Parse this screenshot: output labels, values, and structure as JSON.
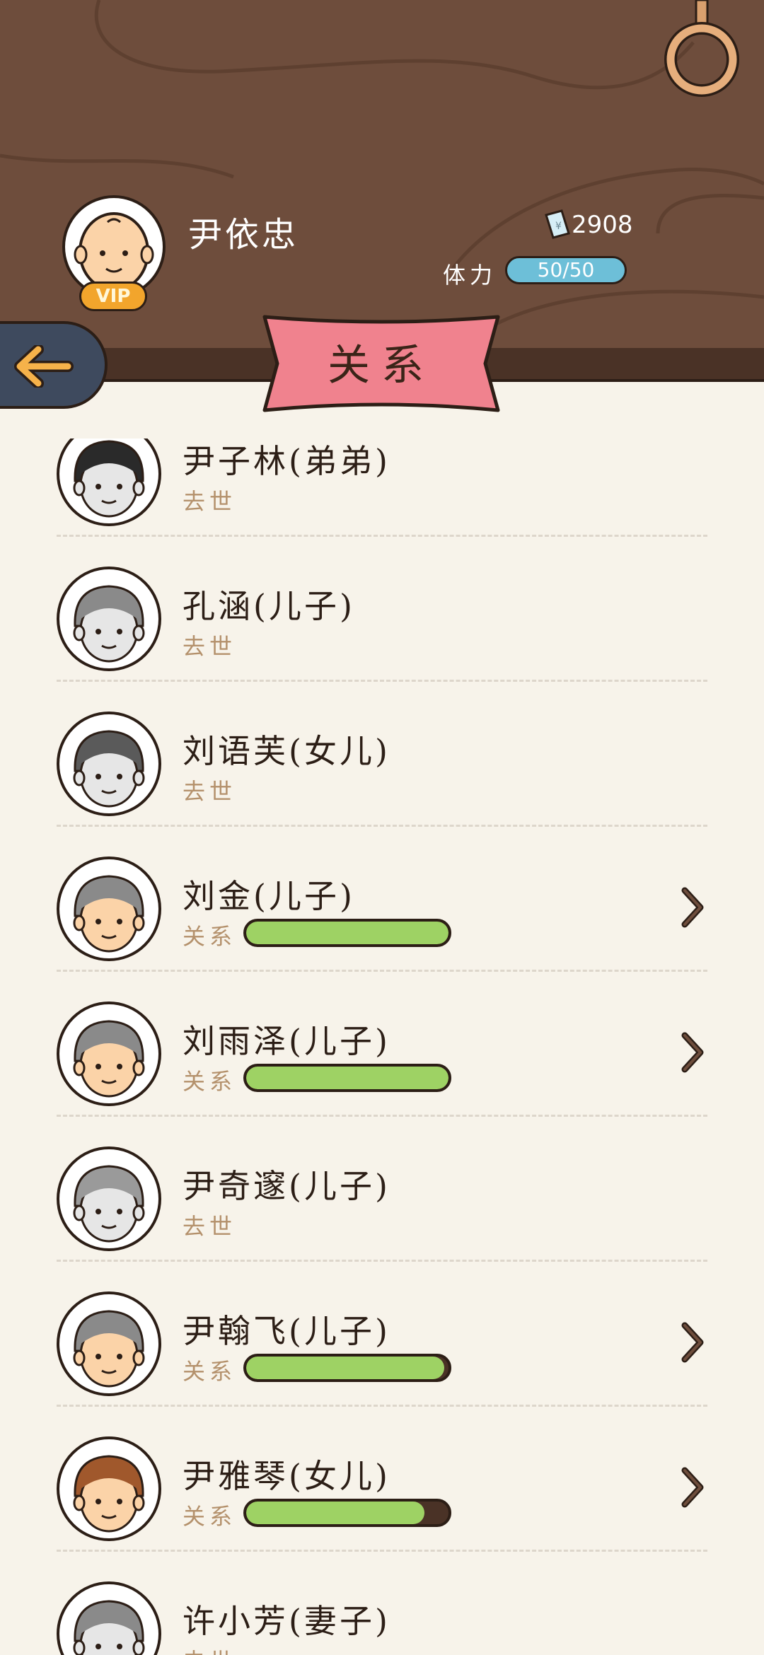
{
  "player": {
    "name": "尹依忠",
    "vip_label": "VIP",
    "money": "2908",
    "stamina_label": "体力",
    "stamina": "50/50"
  },
  "page_title": "关系",
  "colors": {
    "header_bg": "#6e4d3c",
    "banner": "#f0828e",
    "bar_fill": "#9ed264",
    "stamina": "#6dbfd8"
  },
  "relatives": [
    {
      "name": "尹子林(弟弟)",
      "status": "去世",
      "deceased": true,
      "skin": "#e6e6e6",
      "hair": "#2a2a2a"
    },
    {
      "name": "孔涵(儿子)",
      "status": "去世",
      "deceased": true,
      "skin": "#e6e6e6",
      "hair": "#8a8a8a"
    },
    {
      "name": "刘语芙(女儿)",
      "status": "去世",
      "deceased": true,
      "skin": "#e6e6e6",
      "hair": "#5a5a5a"
    },
    {
      "name": "刘金(儿子)",
      "status": "关系",
      "deceased": false,
      "relation": 1.0,
      "skin": "#fbd3a8",
      "hair": "#8a8a8a"
    },
    {
      "name": "刘雨泽(儿子)",
      "status": "关系",
      "deceased": false,
      "relation": 1.0,
      "skin": "#fbd3a8",
      "hair": "#8a8a8a"
    },
    {
      "name": "尹奇邃(儿子)",
      "status": "去世",
      "deceased": true,
      "skin": "#e6e6e6",
      "hair": "#9a9a9a"
    },
    {
      "name": "尹翰飞(儿子)",
      "status": "关系",
      "deceased": false,
      "relation": 0.98,
      "skin": "#fbd3a8",
      "hair": "#8a8a8a"
    },
    {
      "name": "尹雅琴(女儿)",
      "status": "关系",
      "deceased": false,
      "relation": 0.88,
      "skin": "#fbd3a8",
      "hair": "#a0582c"
    },
    {
      "name": "许小芳(妻子)",
      "status": "去世",
      "deceased": true,
      "skin": "#e6e6e6",
      "hair": "#8a8a8a"
    }
  ]
}
